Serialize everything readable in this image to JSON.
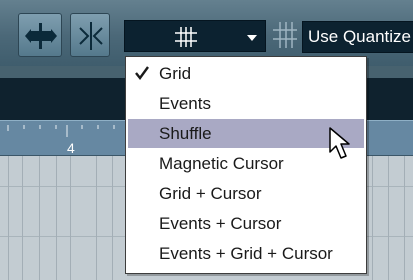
{
  "toolbar": {
    "snap_button_icon": "snap-to-zero-crossing-icon",
    "autoscroll_button_icon": "snap-arrows-icon",
    "snap_mode_value_icon": "grid-icon",
    "quantize_icon": "grid-icon",
    "quantize_label": "Use Quantize"
  },
  "ruler": {
    "bar_label": "4"
  },
  "snap_menu": {
    "items": [
      {
        "label": "Grid",
        "checked": true
      },
      {
        "label": "Events"
      },
      {
        "label": "Shuffle",
        "highlighted": true
      },
      {
        "label": "Magnetic Cursor"
      },
      {
        "label": "Grid + Cursor"
      },
      {
        "label": "Events + Cursor"
      },
      {
        "label": "Events + Grid + Cursor"
      }
    ]
  },
  "colors": {
    "toolbar": "#4b6878",
    "ruler": "#6688a2",
    "menu_highlight": "#a9a9c4",
    "field_bg": "#0c2230"
  }
}
